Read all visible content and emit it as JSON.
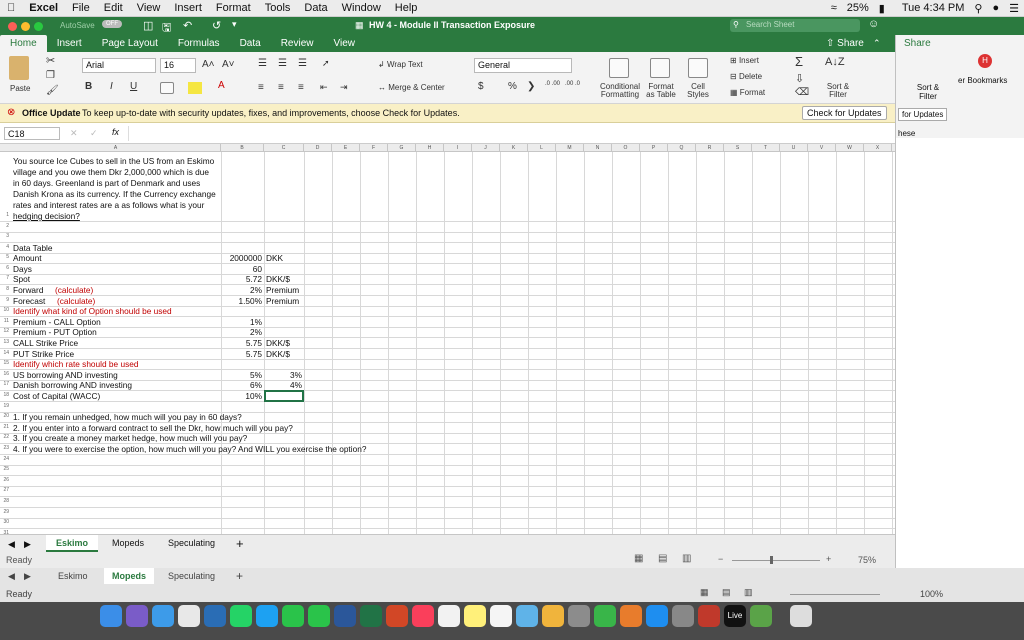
{
  "menubar": {
    "app": "Excel",
    "items": [
      "File",
      "Edit",
      "View",
      "Insert",
      "Format",
      "Tools",
      "Data",
      "Window",
      "Help"
    ],
    "battery": "25%",
    "clock": "Tue 4:34 PM"
  },
  "titlebar": {
    "autosave": "AutoSave",
    "autosave_state": "OFF",
    "title": "HW 4 - Module II Transaction Exposure",
    "search_placeholder": "Search Sheet"
  },
  "ribbon_tabs": [
    "Home",
    "Insert",
    "Page Layout",
    "Formulas",
    "Data",
    "Review",
    "View"
  ],
  "ribbon": {
    "share": "Share",
    "paste": "Paste",
    "font": "Arial",
    "size": "16",
    "wrap": "Wrap Text",
    "merge": "Merge & Center",
    "numfmt": "General",
    "cond": "Conditional Formatting",
    "fmt_table": "Format as Table",
    "cell_styles": "Cell Styles",
    "insert": "Insert",
    "delete": "Delete",
    "format": "Format",
    "sort": "Sort & Filter",
    "bold": "B",
    "italic": "I",
    "underline": "U",
    "currency": "$",
    "percent": "%",
    "comma": "❯",
    "inc_dec": ".0 .00",
    "dec_dec": ".00 .0"
  },
  "update": {
    "title": "Office Update",
    "message": "To keep up-to-date with security updates, fixes, and improvements, choose Check for Updates.",
    "button": "Check for Updates"
  },
  "formula": {
    "namebox": "C18",
    "fx": "fx"
  },
  "sheet": {
    "columns": [
      "A",
      "B",
      "C",
      "D",
      "E",
      "F",
      "G",
      "H",
      "I",
      "J",
      "K",
      "L",
      "M",
      "N",
      "O",
      "P",
      "Q",
      "R",
      "S",
      "T",
      "U",
      "V",
      "W",
      "X"
    ],
    "intro": [
      "You source Ice Cubes to sell in the US from an Eskimo",
      "village and you owe them Dkr 2,000,000 which is due",
      "in 60 days. Greenland is part of Denmark and uses",
      "Danish Krona as its currency. If the Currency exchange",
      "rates and interest rates are a as follows what is your",
      "hedging decision?"
    ],
    "rows": [
      {
        "n": "4",
        "a": "Data Table",
        "b": "",
        "c": ""
      },
      {
        "n": "5",
        "a": "Amount",
        "b": "2000000",
        "c": "DKK"
      },
      {
        "n": "6",
        "a": "Days",
        "b": "60",
        "c": ""
      },
      {
        "n": "7",
        "a": "Spot",
        "b": "5.72",
        "c": "DKK/$"
      },
      {
        "n": "8",
        "a": "Forward",
        "a2": "(calculate)",
        "b": "2%",
        "c": "Premium"
      },
      {
        "n": "9",
        "a": "Forecast",
        "a2": "(calculate)",
        "b": "1.50%",
        "c": "Premium"
      },
      {
        "n": "10",
        "a": "Identify what kind of Option should be used",
        "b": "",
        "c": "",
        "red": true
      },
      {
        "n": "11",
        "a": "Premium - CALL Option",
        "b": "1%",
        "c": ""
      },
      {
        "n": "12",
        "a": "Premium - PUT Option",
        "b": "2%",
        "c": ""
      },
      {
        "n": "13",
        "a": "CALL Strike Price",
        "b": "5.75",
        "c": "DKK/$"
      },
      {
        "n": "14",
        "a": "PUT Strike Price",
        "b": "5.75",
        "c": "DKK/$"
      },
      {
        "n": "15",
        "a": "Identify which rate should be used",
        "b": "",
        "c": "",
        "red": true
      },
      {
        "n": "16",
        "a": "US borrowing AND investing",
        "b": "5%",
        "c": "3%"
      },
      {
        "n": "17",
        "a": "Danish borrowing AND investing",
        "b": "6%",
        "c": "4%"
      },
      {
        "n": "18",
        "a": "Cost of Capital (WACC)",
        "b": "10%",
        "c": ""
      }
    ],
    "questions": [
      "1. If you remain unhedged, how much will you pay in 60 days?",
      "2. If you enter into a forward contract to sell the Dkr, how much will you pay?",
      "3. If you create a money market hedge, how much will you pay?",
      "4. If you were to exercise the option, how much will you pay? And WILL you exercise the option?"
    ]
  },
  "sheet_tabs": [
    "Eskimo",
    "Mopeds",
    "Speculating"
  ],
  "status": {
    "ready": "Ready",
    "zoom": "75%"
  },
  "bg_window": {
    "tabs": [
      "Eskimo",
      "Mopeds",
      "Speculating"
    ],
    "ready": "Ready",
    "zoom": "100%",
    "right_labels": [
      "Share",
      "er Bookmarks",
      "Sort & Filter",
      "for Updates",
      "hese"
    ]
  }
}
